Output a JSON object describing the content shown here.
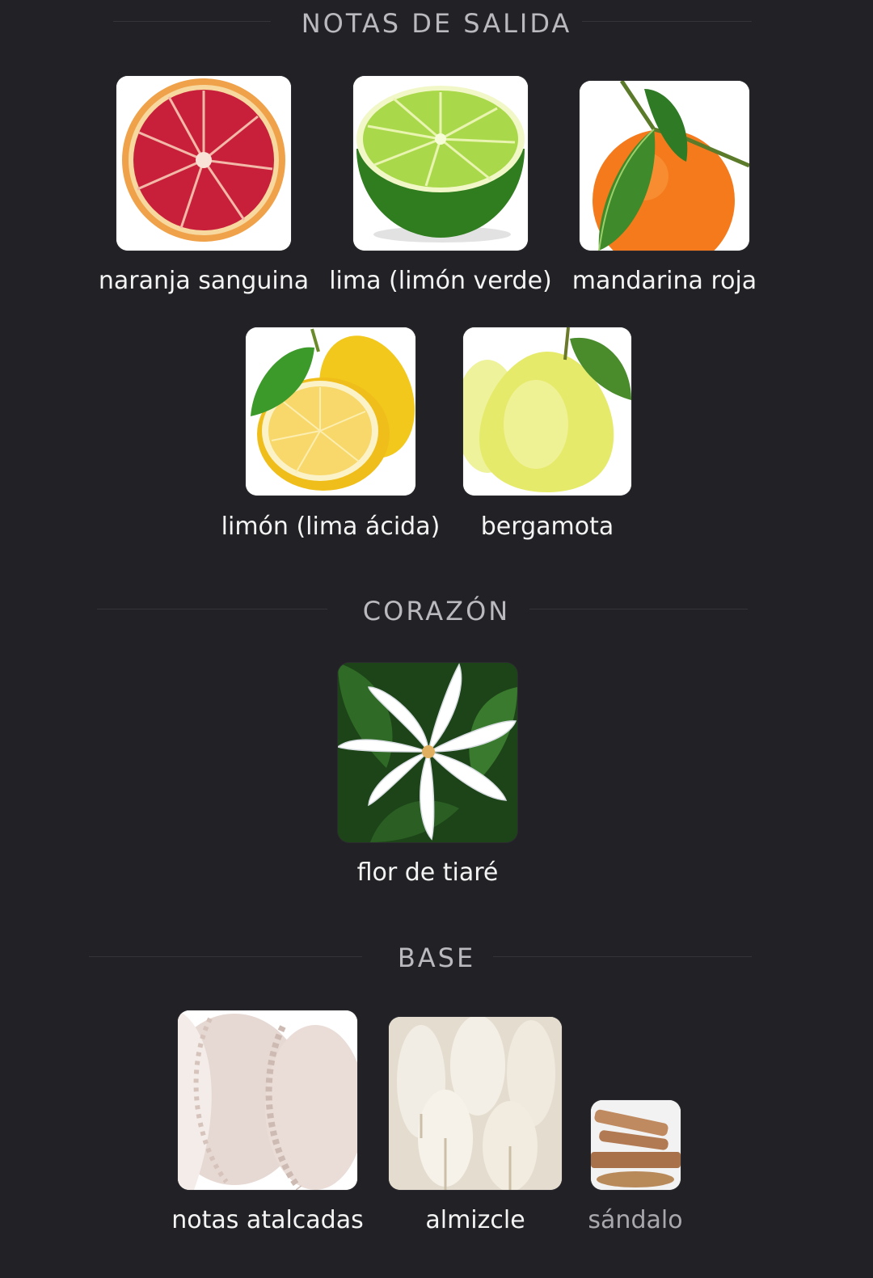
{
  "sections": {
    "top": {
      "title": "NOTAS DE SALIDA",
      "notes": [
        {
          "label": "naranja sanguina",
          "icon": "blood-orange"
        },
        {
          "label": "lima (limón verde)",
          "icon": "lime"
        },
        {
          "label": "mandarina roja",
          "icon": "mandarin"
        },
        {
          "label": "limón (lima ácida)",
          "icon": "lemon"
        },
        {
          "label": "bergamota",
          "icon": "bergamot"
        }
      ]
    },
    "heart": {
      "title": "CORAZÓN",
      "notes": [
        {
          "label": "flor de tiaré",
          "icon": "tiare-flower"
        }
      ]
    },
    "base": {
      "title": "BASE",
      "notes": [
        {
          "label": "notas atalcadas",
          "icon": "powder"
        },
        {
          "label": "almizcle",
          "icon": "musk"
        },
        {
          "label": "sándalo",
          "icon": "sandalwood"
        }
      ]
    }
  }
}
